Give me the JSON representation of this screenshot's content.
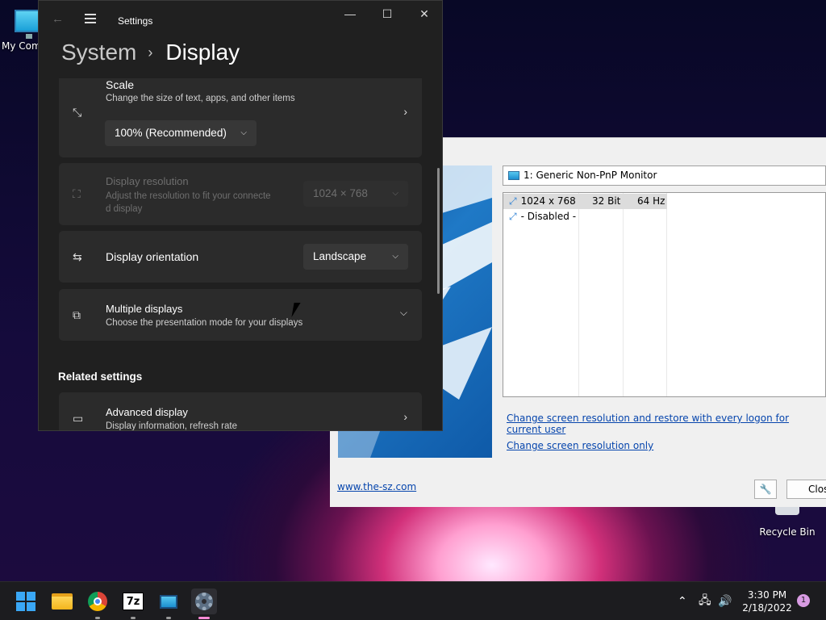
{
  "desktop": {
    "my_computer_label": "My Com",
    "recycle_bin_label": "Recycle Bin"
  },
  "qres": {
    "monitor_select": "1: Generic Non-PnP Monitor",
    "modes": [
      {
        "resolution": "1024 x 768",
        "depth": "32 Bit",
        "freq": "64 Hz"
      },
      {
        "resolution": "- Disabled -",
        "depth": "",
        "freq": ""
      }
    ],
    "link_restore": "Change screen resolution and restore with every logon for current user",
    "link_only": "Change screen resolution only",
    "website": "www.the-sz.com",
    "close_label": "Close"
  },
  "settings": {
    "window_title": "Settings",
    "breadcrumb_parent": "System",
    "breadcrumb_sep": "›",
    "breadcrumb_current": "Display",
    "scale": {
      "title": "Scale",
      "subtitle": "Change the size of text, apps, and other items",
      "value": "100% (Recommended)"
    },
    "resolution": {
      "title": "Display resolution",
      "subtitle_1": "Adjust the resolution to fit your connecte",
      "subtitle_2": "d display",
      "value": "1024 × 768"
    },
    "orientation": {
      "title": "Display orientation",
      "value": "Landscape"
    },
    "multiple": {
      "title": "Multiple displays",
      "subtitle": "Choose the presentation mode for your displays"
    },
    "related_heading": "Related settings",
    "advanced": {
      "title": "Advanced display",
      "subtitle": "Display information, refresh rate"
    }
  },
  "taskbar": {
    "time": "3:30 PM",
    "date": "2/18/2022",
    "notification_count": "1",
    "sevenzip_label": "7z"
  }
}
